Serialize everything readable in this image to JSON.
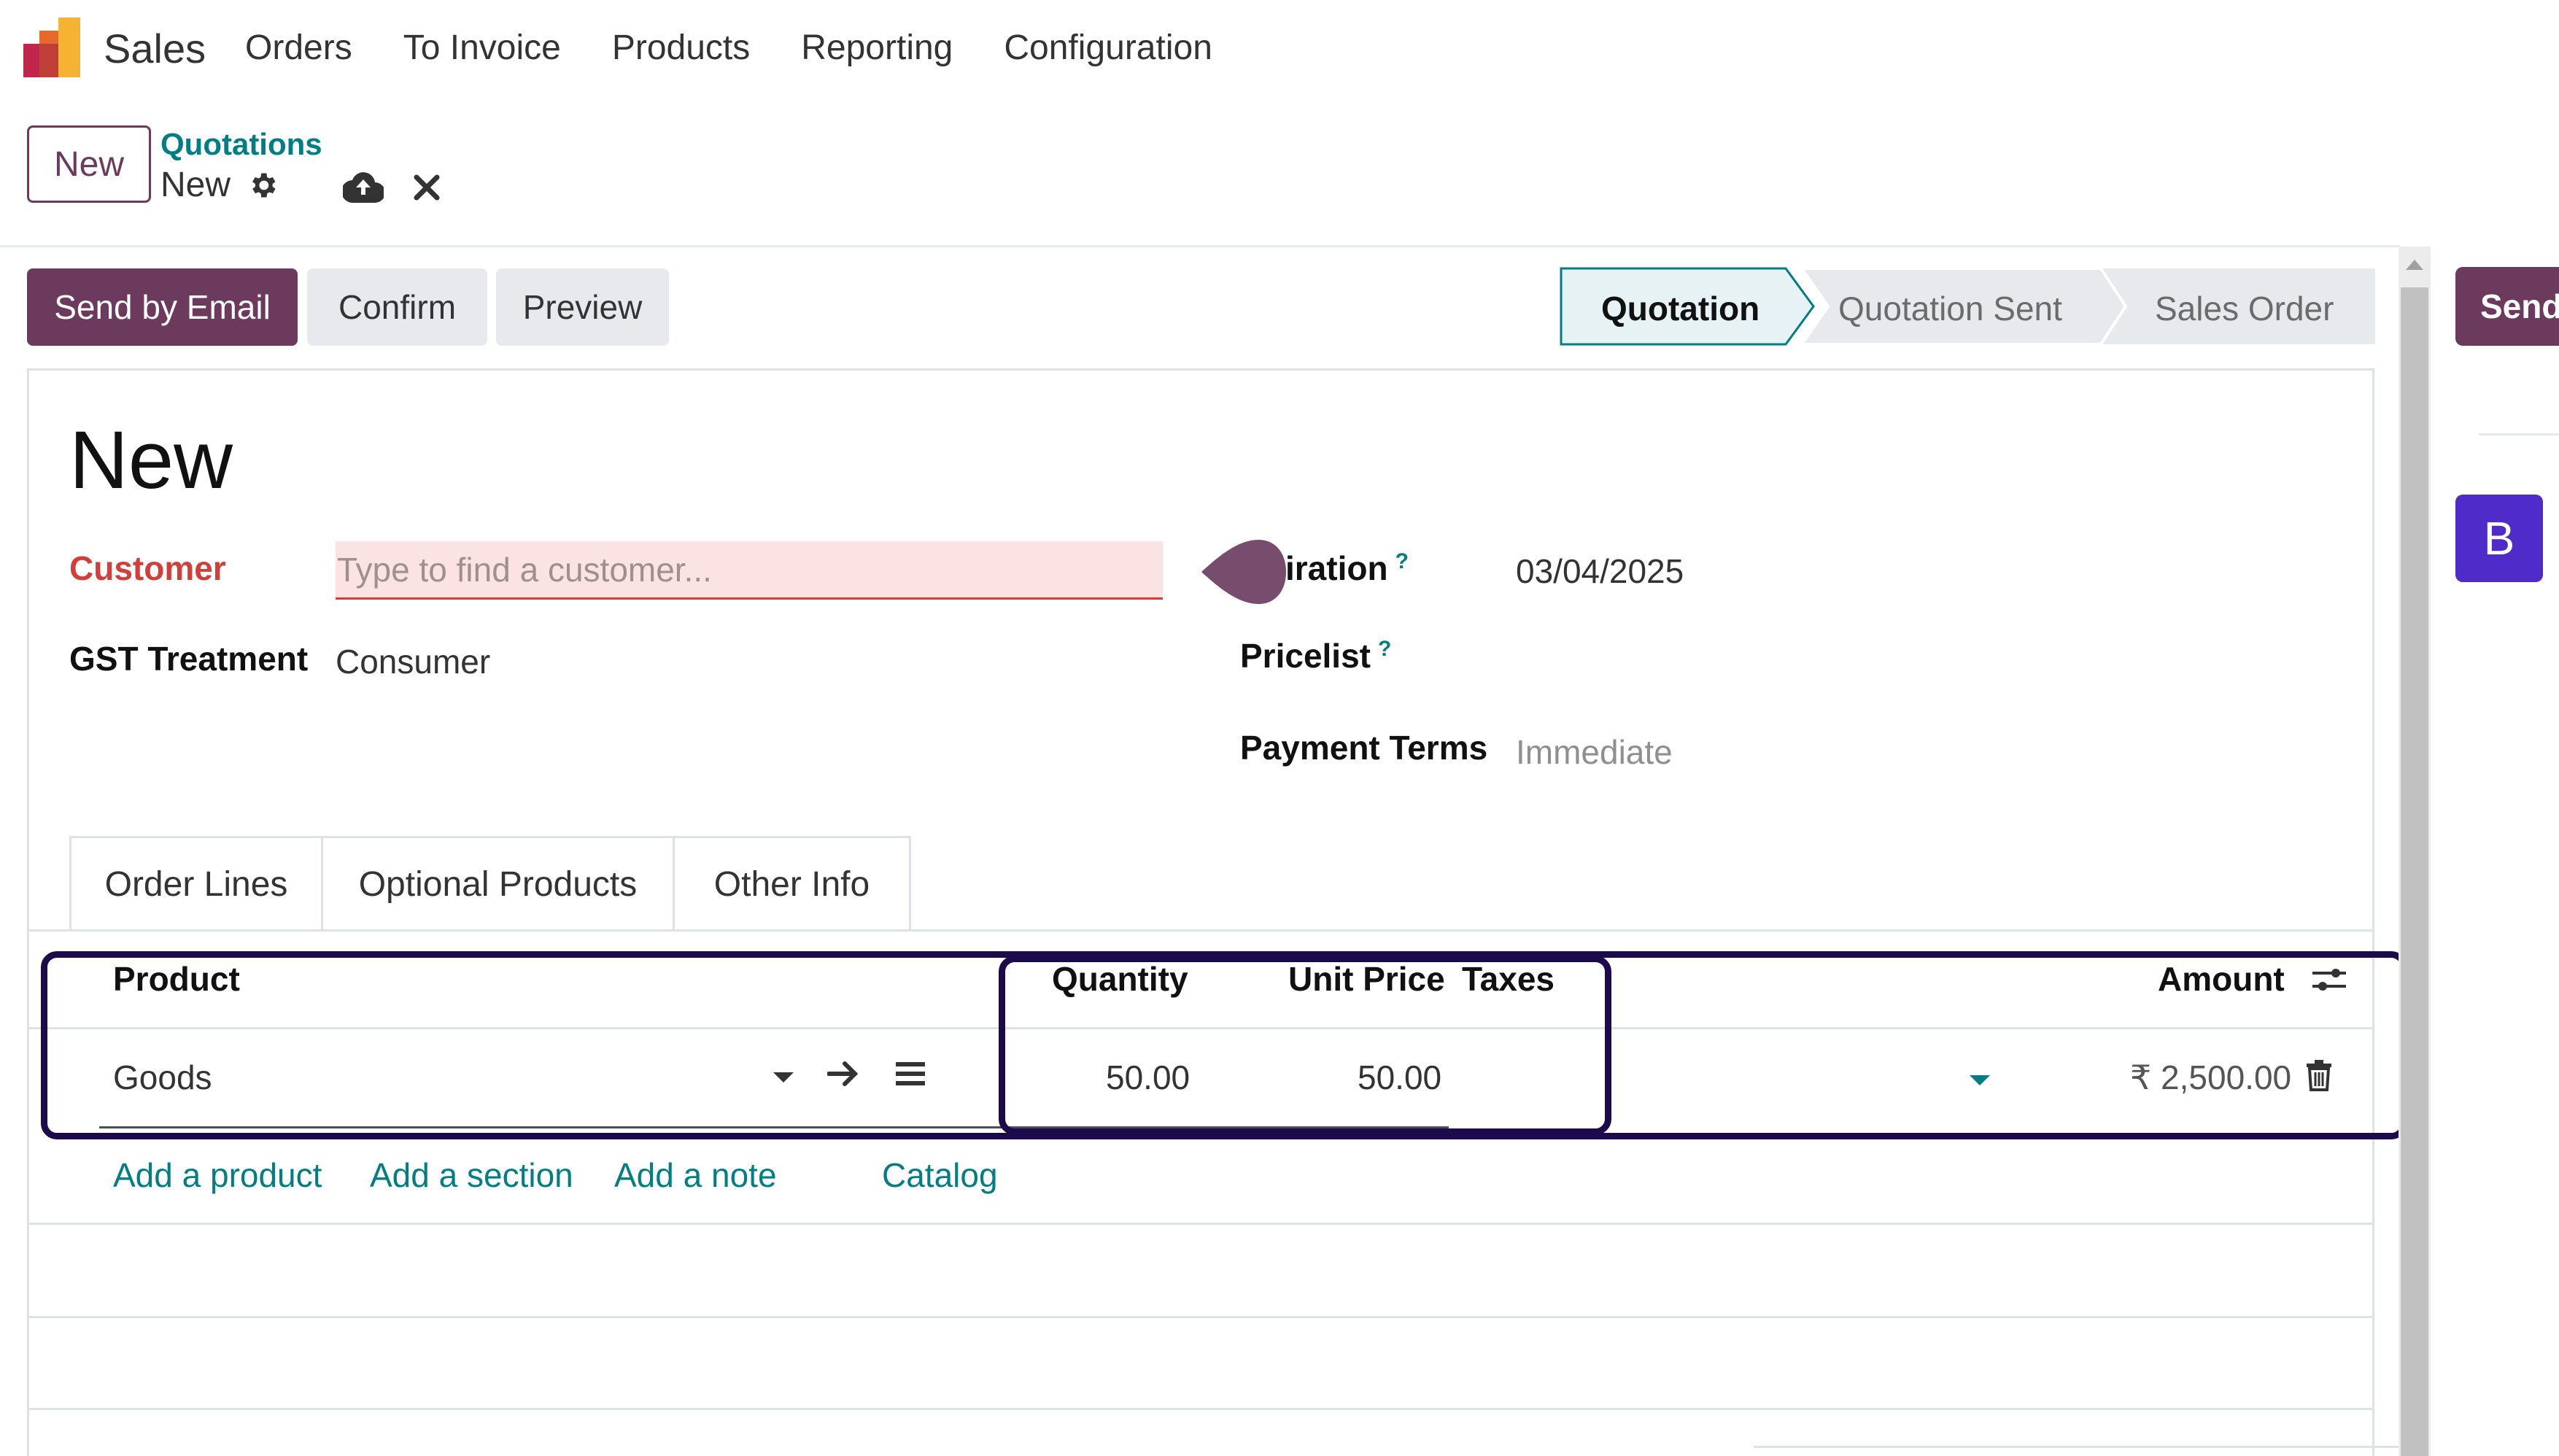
{
  "nav": {
    "app_name": "Sales",
    "menu": [
      "Orders",
      "To Invoice",
      "Products",
      "Reporting",
      "Configuration"
    ]
  },
  "control_panel": {
    "new_button": "New",
    "breadcrumb_parent": "Quotations",
    "breadcrumb_current": "New"
  },
  "statusbar": {
    "send_by_email": "Send by Email",
    "confirm": "Confirm",
    "preview": "Preview",
    "stages": [
      "Quotation",
      "Quotation Sent",
      "Sales Order"
    ],
    "active_stage": "Quotation"
  },
  "form": {
    "title": "New",
    "customer_label": "Customer",
    "customer_placeholder": "Type to find a customer...",
    "gst_label": "GST Treatment",
    "gst_value": "Consumer",
    "expiration_label": "iration",
    "expiration_help": "?",
    "expiration_value": "03/04/2025",
    "pricelist_label": "Pricelist",
    "pricelist_help": "?",
    "payment_terms_label": "Payment Terms",
    "payment_terms_value": "Immediate"
  },
  "tabs": [
    "Order Lines",
    "Optional Products",
    "Other Info"
  ],
  "order_lines": {
    "headers": {
      "product": "Product",
      "quantity": "Quantity",
      "unit_price": "Unit Price",
      "taxes": "Taxes",
      "amount": "Amount"
    },
    "rows": [
      {
        "product": "Goods",
        "quantity": "50.00",
        "unit_price": "50.00",
        "amount": "₹ 2,500.00"
      }
    ],
    "actions": [
      "Add a product",
      "Add a section",
      "Add a note",
      "Catalog"
    ]
  },
  "side_panel": {
    "send_button": "Send",
    "avatar_letter": "B"
  },
  "colors": {
    "primary": "#6c3a5c",
    "link": "#017e84",
    "required": "#d23f3a",
    "highlight_box": "#1c0a4a",
    "avatar": "#4f2cc9"
  }
}
